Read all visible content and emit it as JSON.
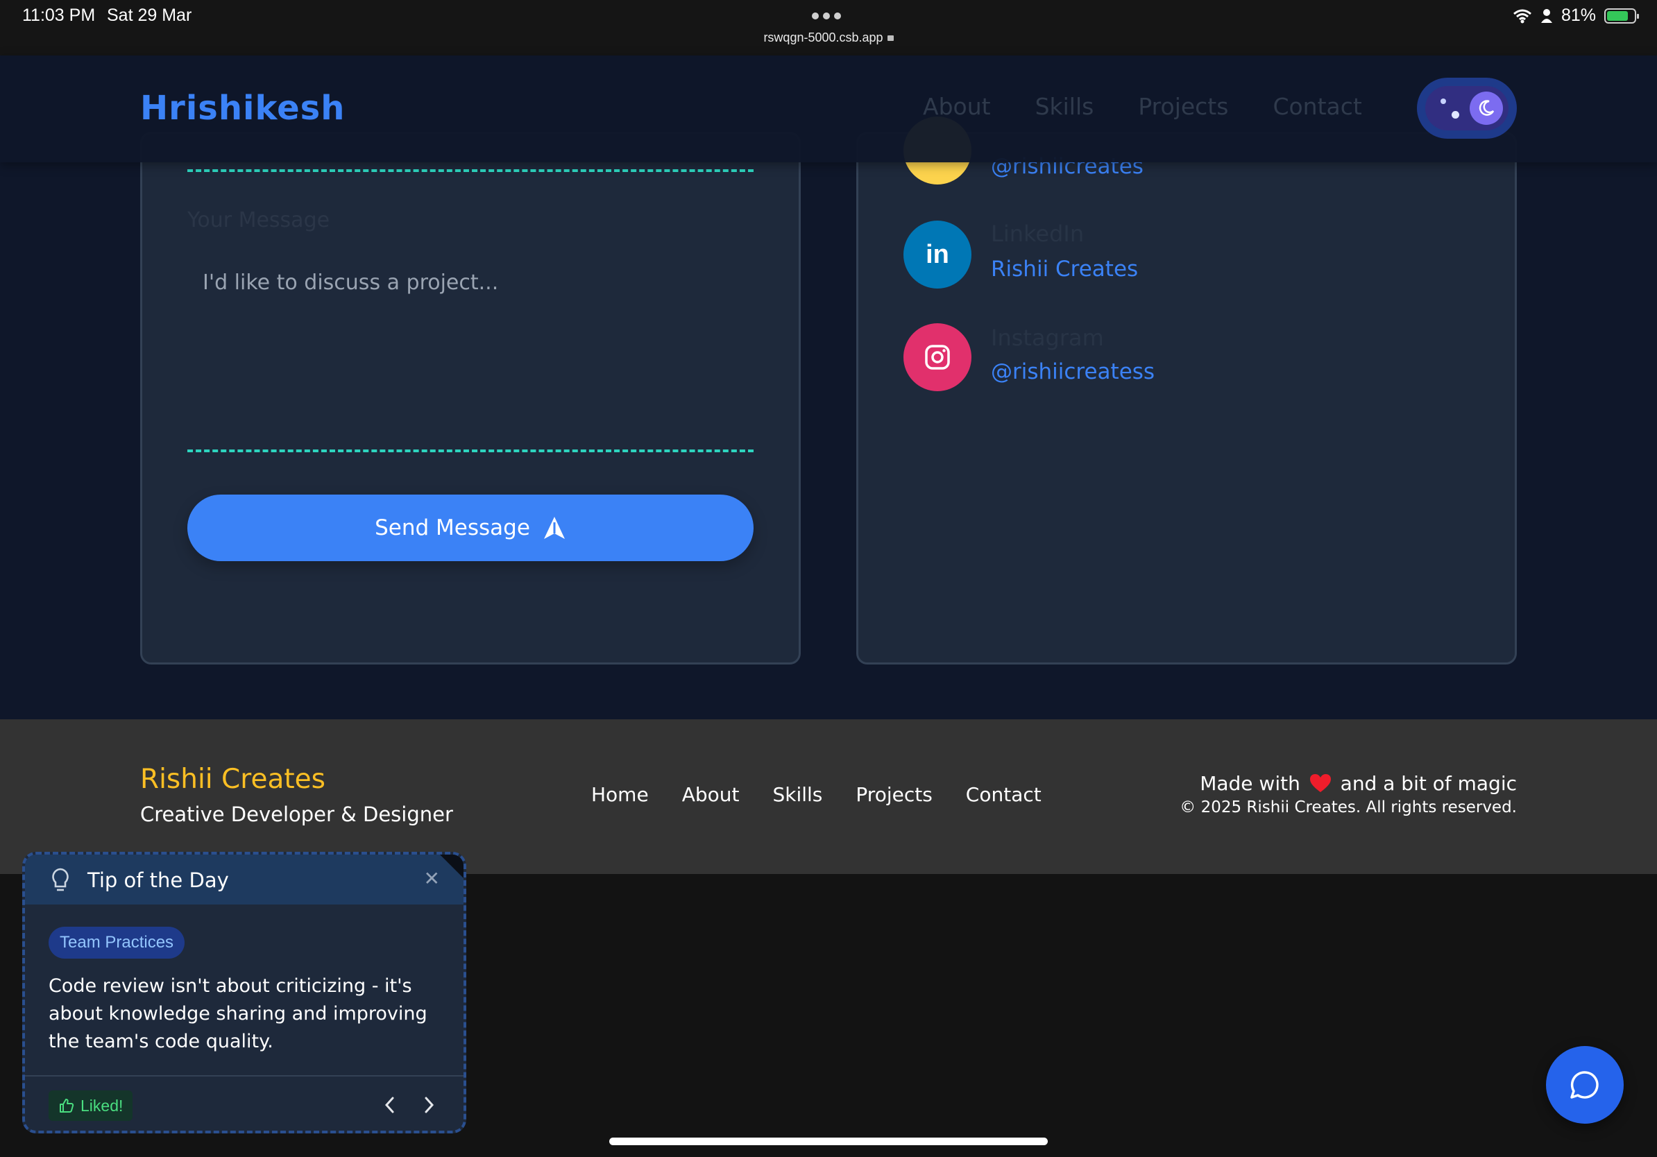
{
  "status_bar": {
    "time": "11:03 PM",
    "date": "Sat 29 Mar",
    "url": "rswqgn-5000.csb.app",
    "battery": "81%"
  },
  "navbar": {
    "logo": "Hrishikesh",
    "links": [
      "About",
      "Skills",
      "Projects",
      "Contact"
    ],
    "theme_toggle": "dark"
  },
  "contact_form": {
    "message_label": "Your Message",
    "message_placeholder": "I'd like to discuss a project...",
    "send_label": "Send Message"
  },
  "socials": [
    {
      "name": "",
      "handle": "@rishiicreates",
      "icon": "github-icon",
      "color": "#fcd34d"
    },
    {
      "name": "LinkedIn",
      "handle": "Rishii Creates",
      "icon": "linkedin-icon",
      "color": "#0077b5"
    },
    {
      "name": "Instagram",
      "handle": "@rishiicreatess",
      "icon": "instagram-icon",
      "color": "#e1306c"
    }
  ],
  "footer": {
    "brand": "Rishii Creates",
    "tagline": "Creative Developer & Designer",
    "links": [
      "Home",
      "About",
      "Skills",
      "Projects",
      "Contact"
    ],
    "made_with_prefix": "Made with",
    "made_with_suffix": "and a bit of magic",
    "copyright": "© 2025 Rishii Creates. All rights reserved."
  },
  "tip": {
    "title": "Tip of the Day",
    "category": "Team Practices",
    "text": "Code review isn't about criticizing - it's about knowledge sharing and improving the team's code quality.",
    "liked_label": "Liked!"
  },
  "colors": {
    "accent": "#3b82f6",
    "background": "#0f172a",
    "card": "#1e293b",
    "dashed": "#2dd4bf",
    "brand_yellow": "#fbbf24"
  }
}
